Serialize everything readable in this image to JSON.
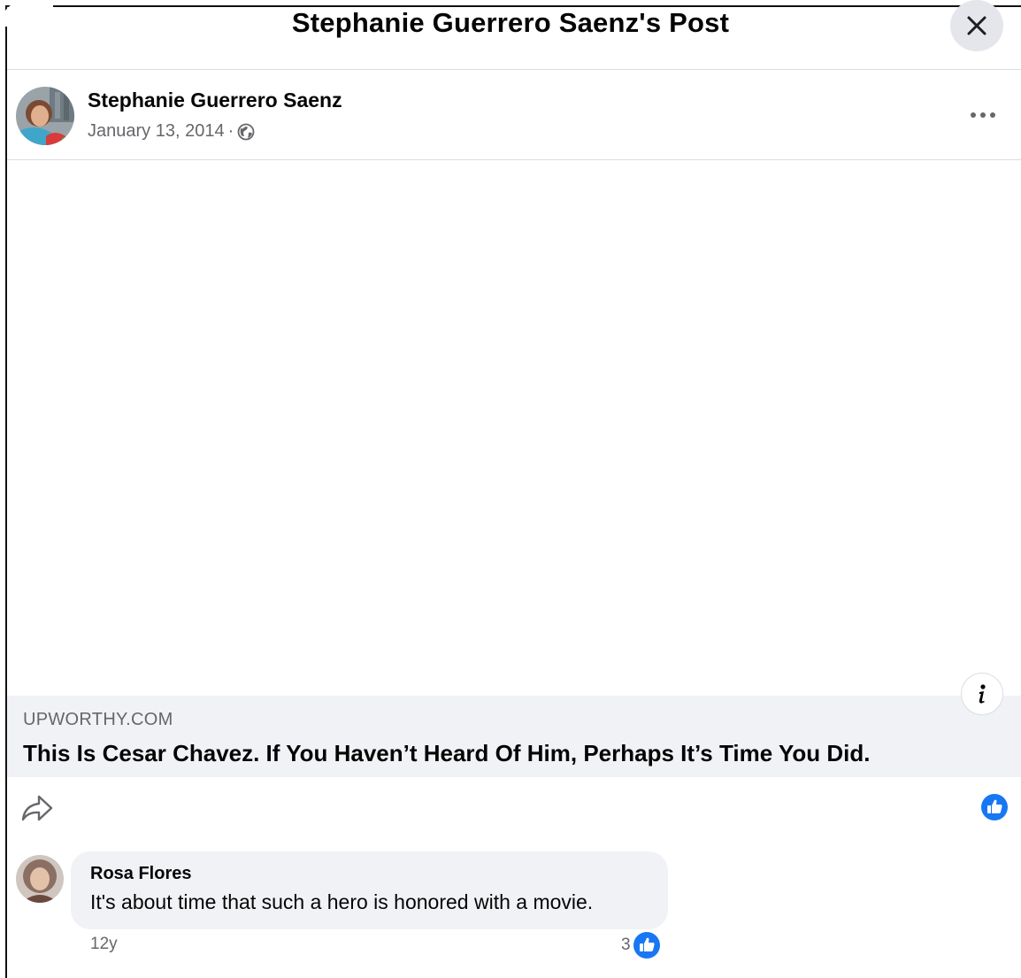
{
  "header": {
    "title": "Stephanie Guerrero Saenz's Post"
  },
  "post": {
    "author": "Stephanie Guerrero Saenz",
    "date": "January 13, 2014",
    "separator": "·",
    "audience_icon": "globe-icon",
    "link": {
      "domain": "UPWORTHY.COM",
      "title": "This Is Cesar Chavez. If You Haven’t Heard Of Him, Perhaps It’s Time You Did."
    },
    "reaction_icon": "like-icon"
  },
  "comment": {
    "author": "Rosa Flores",
    "text": "It's about time that such a hero is honored with a movie.",
    "time": "12y",
    "reaction_count": "3"
  },
  "colors": {
    "like_blue": "#1877f2",
    "secondary_text": "#65676b",
    "bubble_bg": "#f0f2f5"
  }
}
